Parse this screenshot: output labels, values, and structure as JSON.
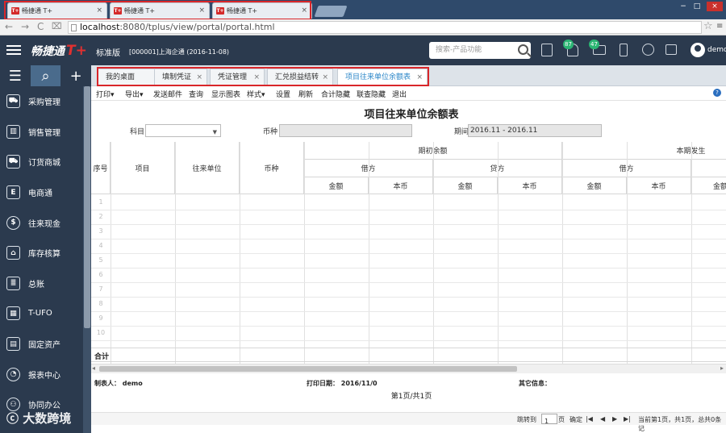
{
  "browser": {
    "tabs": [
      {
        "favicon": "T+",
        "title": "畅捷通 T+"
      },
      {
        "favicon": "T+",
        "title": "畅捷通 T+"
      },
      {
        "favicon": "T+",
        "title": "畅捷通 T+"
      }
    ],
    "url_host": "localhost",
    "url_rest": ":8080/tplus/view/portal/portal.html"
  },
  "header": {
    "logo": "畅捷通",
    "logo_mark": "T+",
    "edition": "标准版",
    "company": "[000001]上海企通    (2016-11-08)",
    "search_placeholder": "搜索-产品功能",
    "badges": {
      "notifications": "87",
      "messages": "47"
    },
    "username": "demo"
  },
  "sidebar": {
    "items": [
      {
        "label": "采购管理",
        "icon": "cart-icon"
      },
      {
        "label": "销售管理",
        "icon": "bar-chart-icon"
      },
      {
        "label": "订货商城",
        "icon": "shop-cart-icon"
      },
      {
        "label": "电商通",
        "icon": "ecommerce-icon"
      },
      {
        "label": "往来现金",
        "icon": "dollar-icon"
      },
      {
        "label": "库存核算",
        "icon": "warehouse-icon"
      },
      {
        "label": "总账",
        "icon": "ledger-icon"
      },
      {
        "label": "T-UFO",
        "icon": "spreadsheet-icon"
      },
      {
        "label": "固定资产",
        "icon": "asset-icon"
      },
      {
        "label": "报表中心",
        "icon": "pie-chart-icon"
      },
      {
        "label": "协同办公",
        "icon": "collaboration-icon"
      }
    ],
    "watermark": "大数跨境"
  },
  "page_tabs": [
    {
      "label": "我的桌面",
      "closable": false
    },
    {
      "label": "填制凭证",
      "closable": true
    },
    {
      "label": "凭证管理",
      "closable": true
    },
    {
      "label": "汇兑损益结转",
      "closable": true
    },
    {
      "label": "项目往来单位余额表",
      "closable": true,
      "active": true
    }
  ],
  "toolbar": [
    "打印▾",
    "导出▾",
    "发送邮件",
    "查询",
    "显示图表",
    "样式▾",
    "设置",
    "刷新",
    "合计隐藏",
    "联查隐藏",
    "退出"
  ],
  "report": {
    "title": "项目往来单位余额表",
    "filters": {
      "subject_label": "科目",
      "subject_value": "",
      "currency_label": "币种",
      "currency_value": "",
      "period_label": "期间",
      "period_value": "2016.11 - 2016.11"
    },
    "headers": {
      "seq": "序号",
      "project": "项目",
      "partner": "往来单位",
      "currency": "币种",
      "opening": "期初余额",
      "current": "本期发生",
      "debit": "借方",
      "credit": "贷方",
      "amount": "金额",
      "local": "本币",
      "amount_cut": "金额"
    },
    "row_numbers": [
      "1",
      "2",
      "3",
      "4",
      "5",
      "6",
      "7",
      "8",
      "9",
      "10"
    ],
    "total_label": "合计",
    "maker": "制表人： demo",
    "print_date": "打印日期： 2016/11/0",
    "other_info": "其它信息：",
    "page_info": "第1页/共1页"
  },
  "pager": {
    "goto": "跳转到",
    "page_value": "1",
    "page_unit": "页",
    "confirm": "确定",
    "nav_first": "|◀",
    "nav_prev": "◀",
    "nav_next": "▶",
    "nav_last": "▶|",
    "status": "当前第1页，共1页，总共0条记"
  }
}
